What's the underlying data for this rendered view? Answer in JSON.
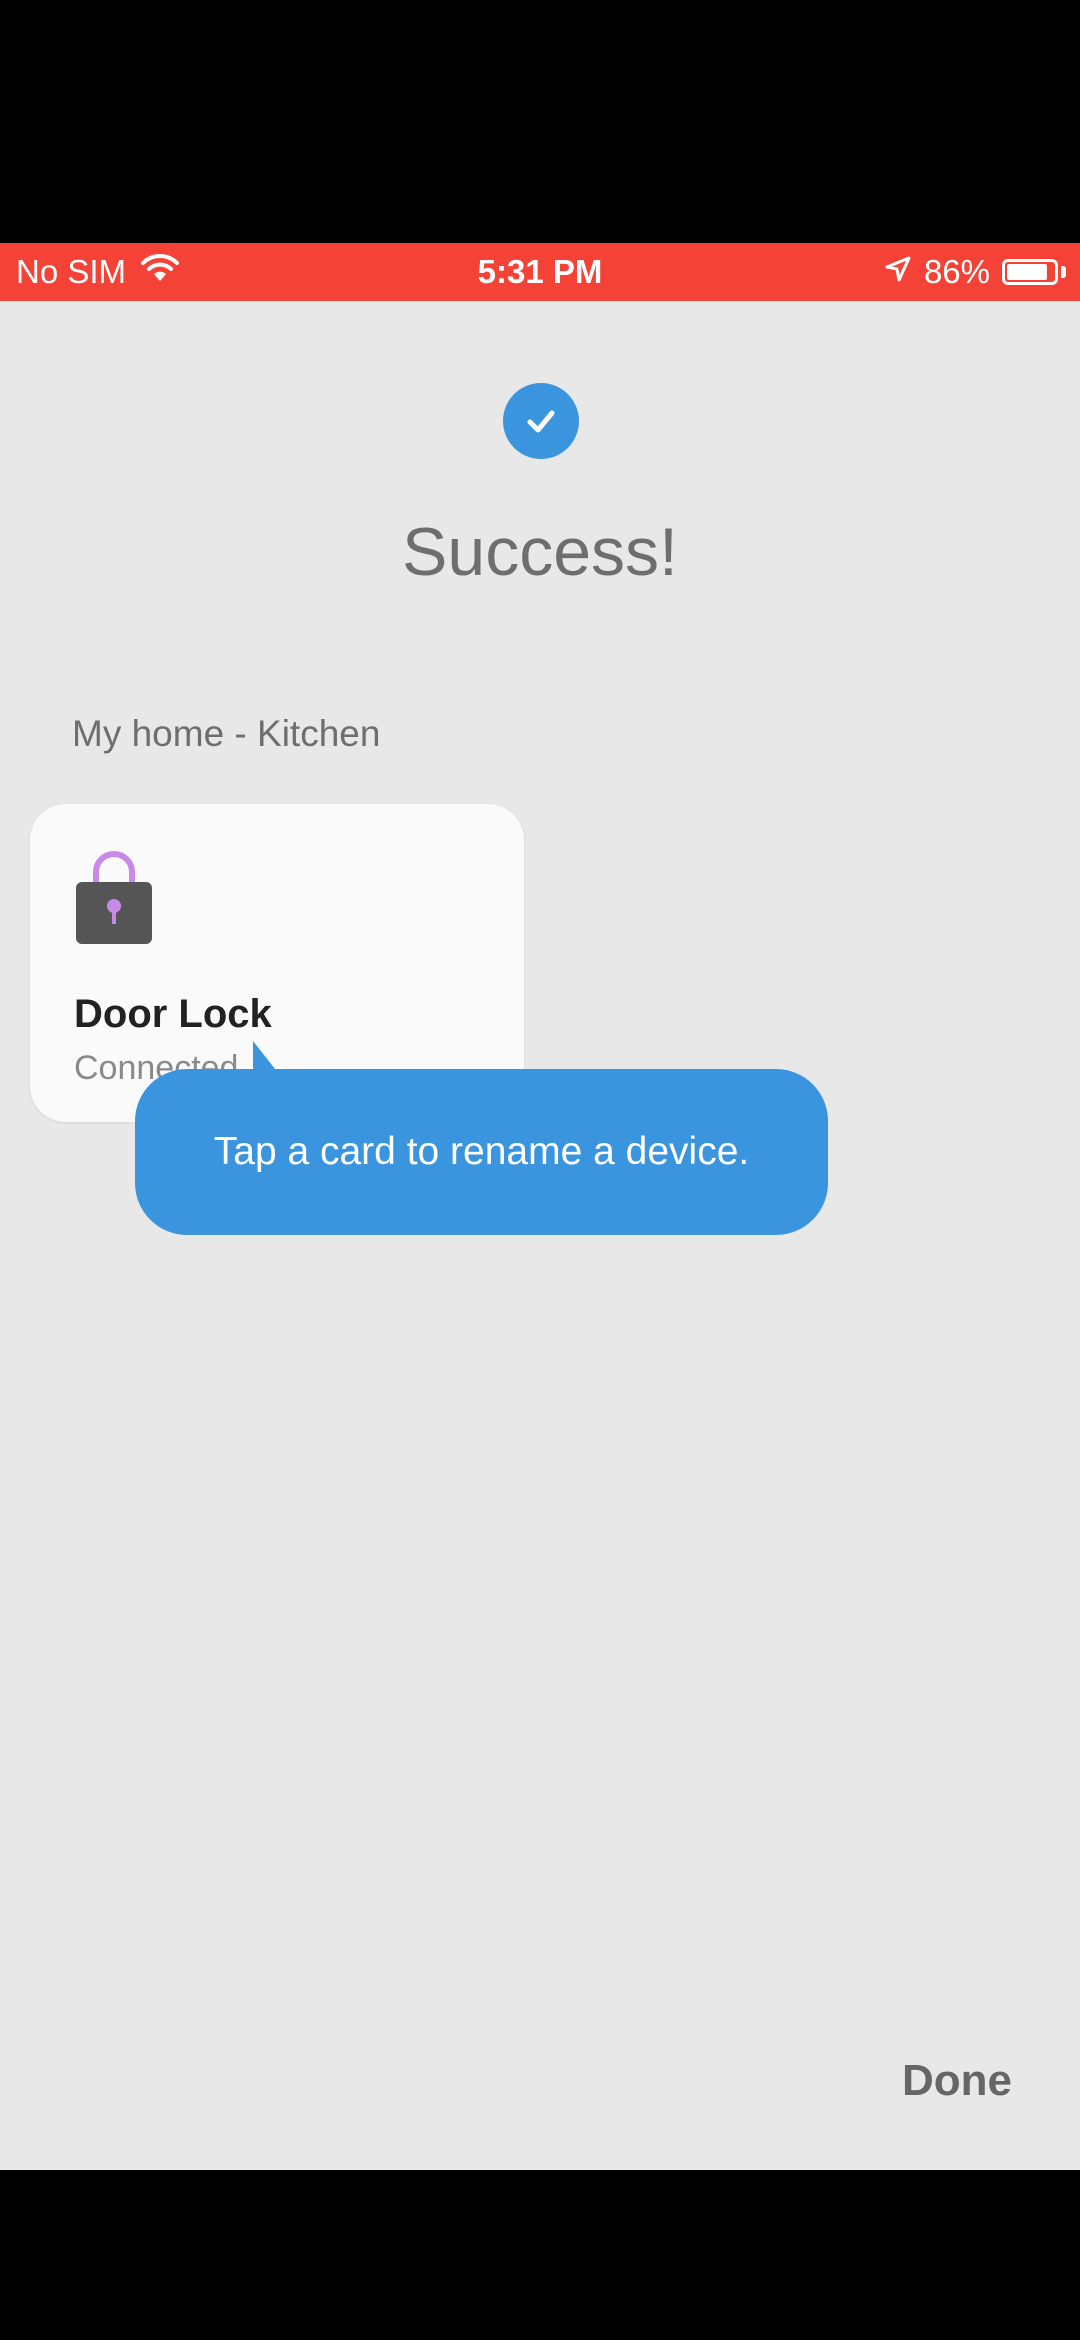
{
  "status_bar": {
    "carrier": "No SIM",
    "time": "5:31 PM",
    "battery_percent_label": "86%",
    "battery_level": 0.86,
    "icons": [
      "wifi-icon",
      "location-arrow-icon",
      "battery-icon"
    ],
    "background_color": "#f44336"
  },
  "header": {
    "success_icon": "check-circle-icon",
    "title": "Success!"
  },
  "location_label": "My home - Kitchen",
  "device_card": {
    "icon": "lock-icon",
    "name": "Door Lock",
    "status": "Connected"
  },
  "tooltip": {
    "text": "Tap a card to rename a device."
  },
  "footer": {
    "done_label": "Done"
  },
  "colors": {
    "accent": "#3a95de",
    "screen_background": "#e8e8e8",
    "lock_shackle": "#c78ae8",
    "lock_body": "#555555"
  }
}
